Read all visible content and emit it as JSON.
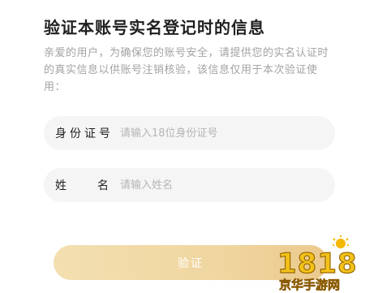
{
  "header": {
    "title": "验证本账号实名登记时的信息"
  },
  "description": "亲爱的用户，为确保您的账号安全，请提供您的实名认证时的真实信息以供账号注销核验，该信息仅用于本次验证使用：",
  "form": {
    "id_field": {
      "label": "身份证号",
      "placeholder": "请输入18位身份证号",
      "value": ""
    },
    "name_field": {
      "label_left": "姓",
      "label_right": "名",
      "placeholder": "请输入姓名",
      "value": ""
    },
    "submit_label": "验证"
  },
  "watermark": {
    "logo_text": "1818",
    "site_text": "京华手游网"
  },
  "colors": {
    "accent": "#f0d6a0",
    "title": "#1f1f1f",
    "muted": "#a3a3a3",
    "field_bg": "#f5f5f5",
    "watermark": "#f0b400"
  }
}
